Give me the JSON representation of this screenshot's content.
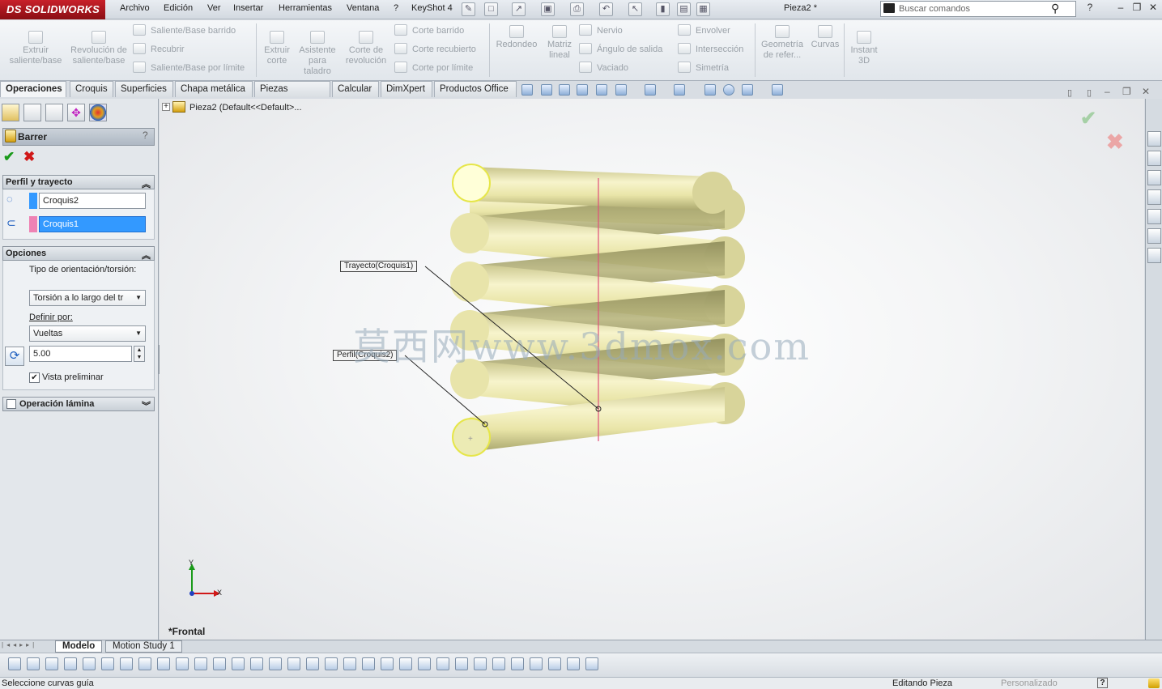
{
  "app": {
    "logo": "DS SOLIDWORKS",
    "doc_title": "Pieza2 *"
  },
  "menu": [
    "Archivo",
    "Edición",
    "Ver",
    "Insertar",
    "Herramientas",
    "Ventana",
    "?",
    "KeyShot 4"
  ],
  "search": {
    "placeholder": "Buscar comandos"
  },
  "ribbon": {
    "extruir": "Extruir saliente/base",
    "revolucion": "Revolución de saliente/base",
    "saliente_barrido": "Saliente/Base barrido",
    "recubrir": "Recubrir",
    "saliente_limite": "Saliente/Base por límite",
    "extruir_corte": "Extruir corte",
    "asistente": "Asistente para taladro",
    "corte_revolucion": "Corte de revolución",
    "corte_barrido": "Corte barrido",
    "corte_recubierto": "Corte recubierto",
    "corte_limite": "Corte por límite",
    "redondeo": "Redondeo",
    "matriz": "Matriz lineal",
    "nervio": "Nervio",
    "angulo": "Ángulo de salida",
    "vaciado": "Vaciado",
    "envolver": "Envolver",
    "interseccion": "Intersección",
    "simetria": "Simetría",
    "geometria": "Geometría de refer...",
    "curvas": "Curvas",
    "instant3d": "Instant 3D"
  },
  "tabs": [
    "Operaciones",
    "Croquis",
    "Superficies",
    "Chapa metálica",
    "Piezas soldadas",
    "Calcular",
    "DimXpert",
    "Productos Office"
  ],
  "property_manager": {
    "title": "Barrer",
    "help": "?",
    "perfil_group": "Perfil y trayecto",
    "profile_value": "Croquis2",
    "path_value": "Croquis1",
    "opciones_group": "Opciones",
    "orientation_label": "Tipo de orientación/torsión:",
    "orientation_value": "Torsión a lo largo del tr",
    "define_label": "Definir por:",
    "define_value": "Vueltas",
    "turns_value": "5.00",
    "preview_label": "Vista preliminar",
    "thin_feature": "Operación lámina"
  },
  "tree": {
    "root": "Pieza2  (Default<<Default>..."
  },
  "callouts": {
    "path": "Trayecto(Croquis1)",
    "profile": "Perfil(Croquis2)"
  },
  "view": {
    "name": "*Frontal",
    "axis_y": "Y",
    "axis_x": "X"
  },
  "watermark": "莫西网www.3dmox.com",
  "bottom_tabs": [
    "Modelo",
    "Motion Study 1"
  ],
  "status": {
    "left": "Seleccione curvas guía",
    "mode": "Editando Pieza",
    "units": "Personalizado",
    "help": "?"
  },
  "colors": {
    "spring": "#ebe6a6",
    "accent_red": "#c8202a",
    "selection_blue": "#3399ff",
    "pink": "#ee82b4"
  }
}
